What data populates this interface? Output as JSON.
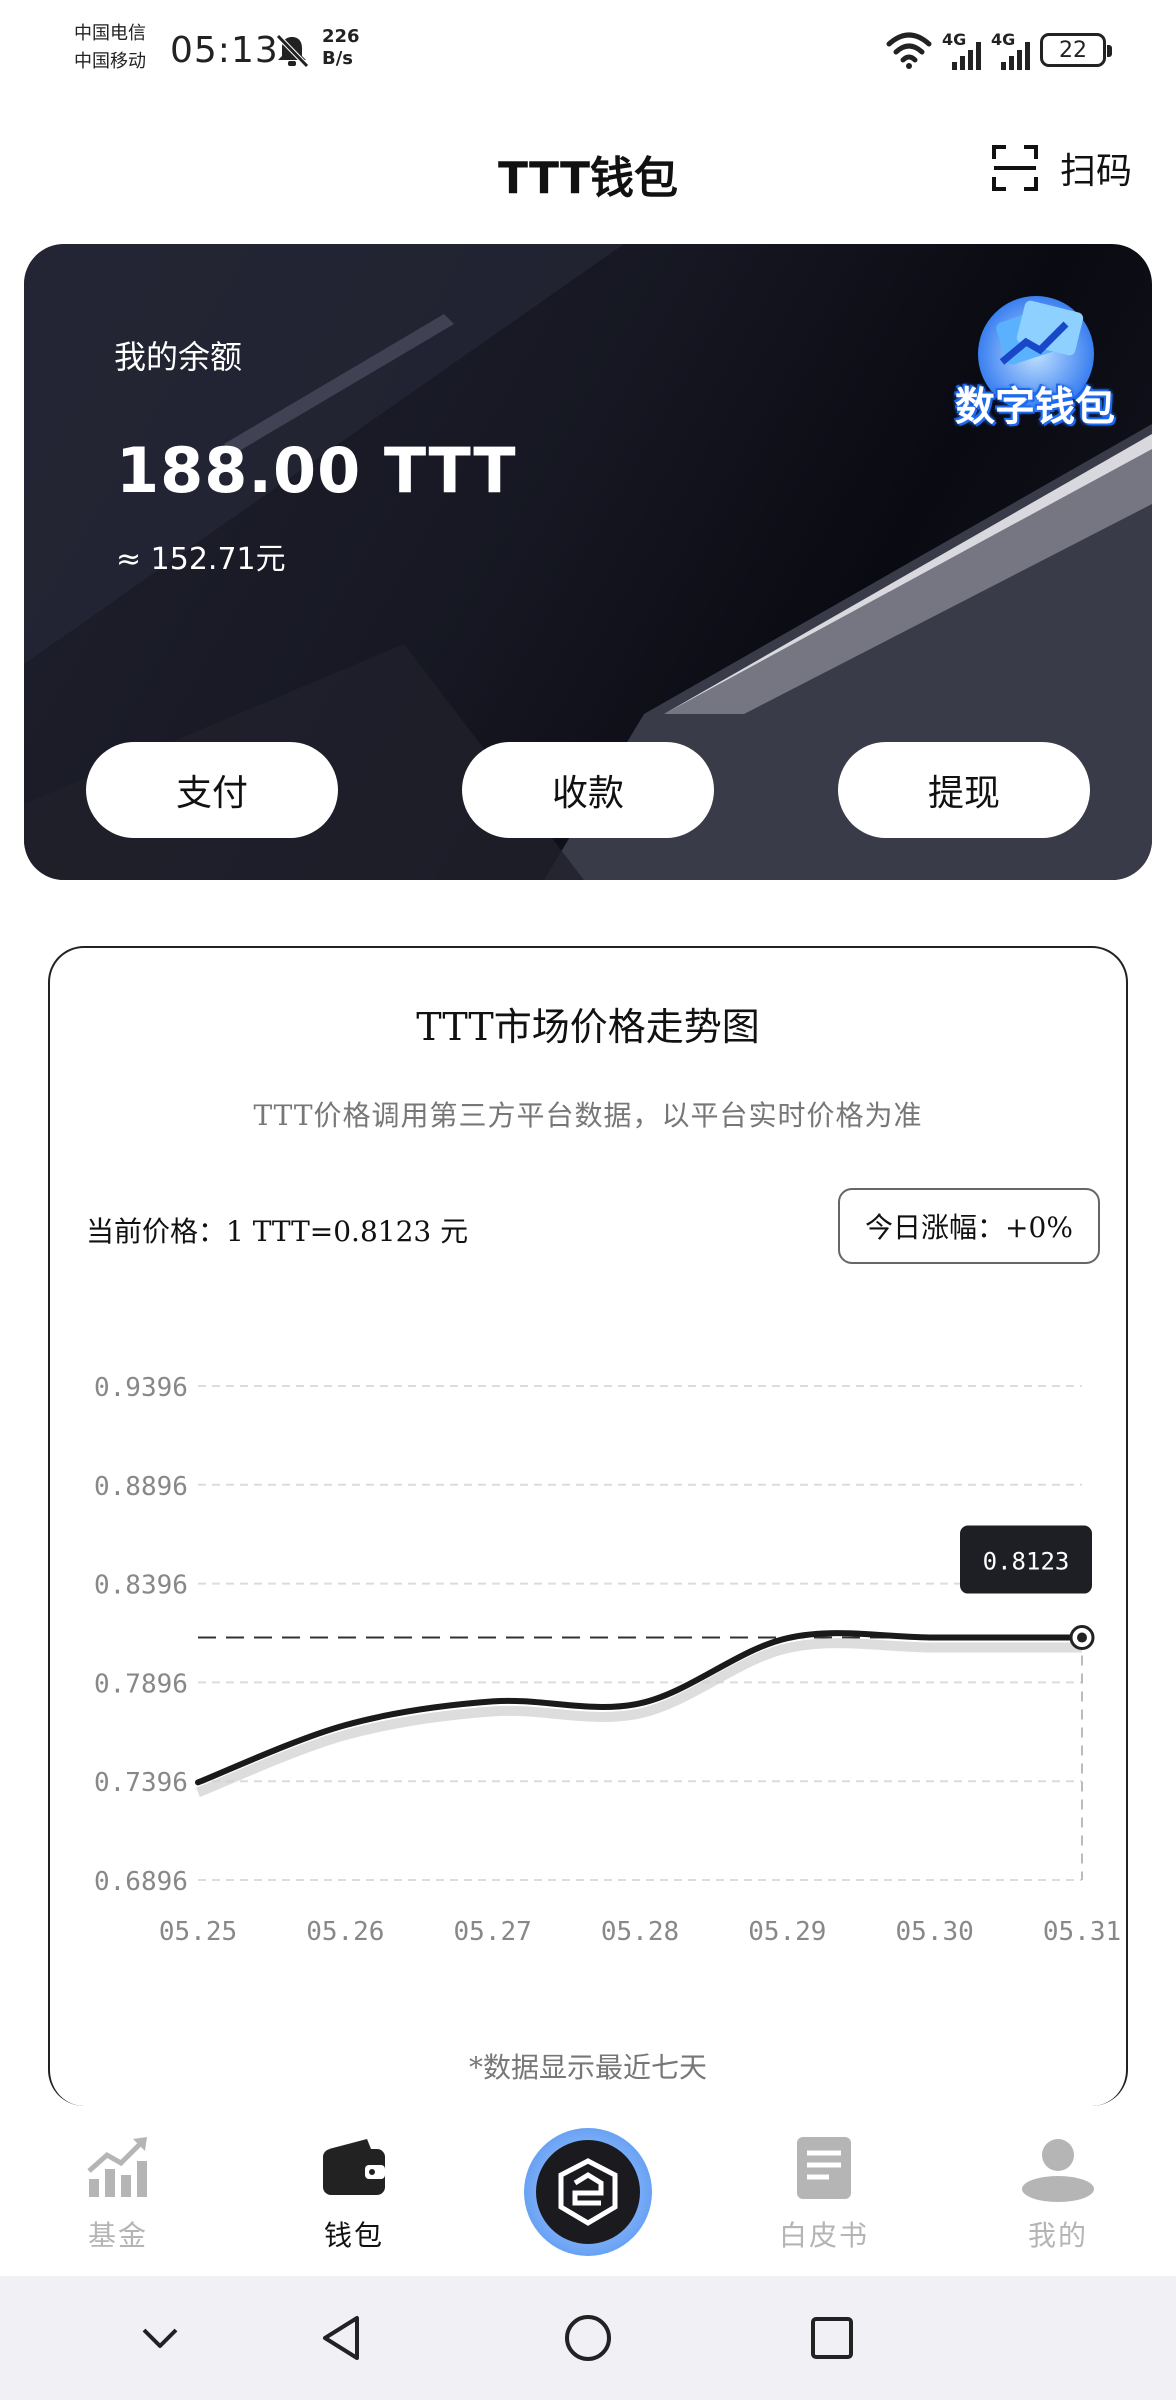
{
  "status_bar": {
    "carrier1": "中国电信",
    "carrier2": "中国移动",
    "time": "05:13",
    "speed_value": "226",
    "speed_unit": "B/s",
    "network1": "4G",
    "network2": "4G",
    "battery": "22"
  },
  "header": {
    "title": "TTT钱包",
    "scan_label": "扫码"
  },
  "balance_card": {
    "label": "我的余额",
    "amount": "188.00 TTT",
    "approx_cny": "≈ 152.71元",
    "badge_text": "数字钱包",
    "actions": [
      "支付",
      "收款",
      "提现"
    ]
  },
  "chart_section": {
    "title": "TTT市场价格走势图",
    "subtitle": "TTT价格调用第三方平台数据，以平台实时价格为准",
    "current_price": "当前价格：1 TTT=0.8123 元",
    "daily_change": "今日涨幅：+0%",
    "note": "*数据显示最近七天"
  },
  "chart_data": {
    "type": "line",
    "title": "TTT市场价格走势图",
    "xlabel": "",
    "ylabel": "",
    "categories": [
      "05.25",
      "05.26",
      "05.27",
      "05.28",
      "05.29",
      "05.30",
      "05.31"
    ],
    "series": [
      {
        "values": [
          0.739,
          0.768,
          0.78,
          0.779,
          0.812,
          0.8123,
          0.8123
        ]
      }
    ],
    "y_ticks": [
      "0.6896",
      "0.7396",
      "0.7896",
      "0.8396",
      "0.8896",
      "0.9396"
    ],
    "ylim": [
      0.6896,
      0.9396
    ],
    "grid": true,
    "reference_line": 0.8123,
    "tooltip": {
      "category": "05.31",
      "label": "0.8123"
    },
    "line_color": "#1a1a1a"
  },
  "bottom_nav": {
    "items": [
      {
        "label": "基金",
        "icon": "chart-growth-icon",
        "active": false
      },
      {
        "label": "钱包",
        "icon": "wallet-icon",
        "active": true
      },
      {
        "label": "",
        "icon": "app-logo-icon",
        "active": false
      },
      {
        "label": "白皮书",
        "icon": "document-icon",
        "active": false
      },
      {
        "label": "我的",
        "icon": "user-icon",
        "active": false
      }
    ]
  },
  "colors": {
    "card_dark": "#161722",
    "accent_blue": "#4a8ef0",
    "inactive_gray": "#b5b5b5"
  }
}
